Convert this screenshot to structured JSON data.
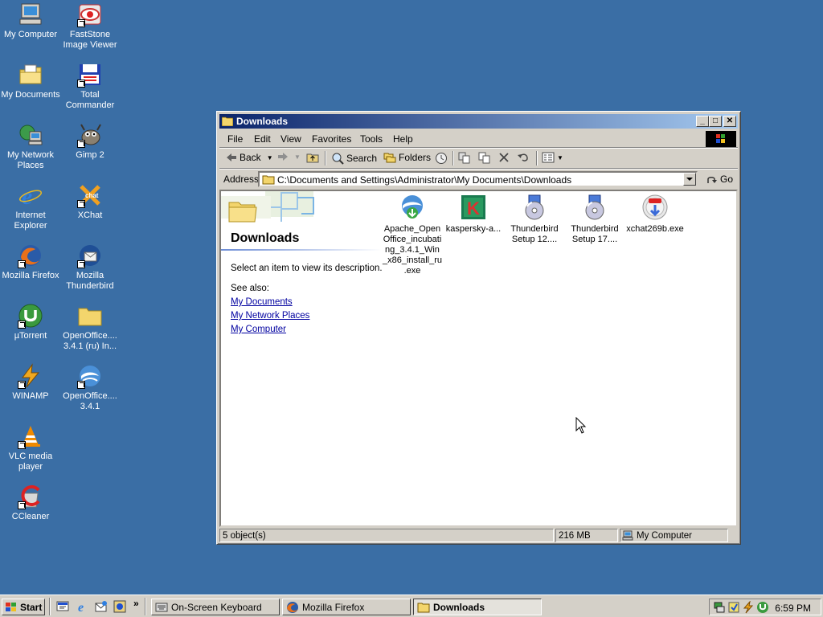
{
  "desktop": {
    "icons": [
      {
        "label": "My Computer",
        "icon": "my-computer-icon"
      },
      {
        "label": "FastStone Image Viewer",
        "icon": "faststone-icon"
      },
      {
        "label": "My Documents",
        "icon": "my-documents-icon"
      },
      {
        "label": "Total Commander",
        "icon": "total-commander-icon"
      },
      {
        "label": "My Network Places",
        "icon": "network-places-icon"
      },
      {
        "label": "Gimp 2",
        "icon": "gimp-icon"
      },
      {
        "label": "Internet Explorer",
        "icon": "internet-explorer-icon"
      },
      {
        "label": "XChat",
        "icon": "xchat-icon"
      },
      {
        "label": "Mozilla Firefox",
        "icon": "firefox-icon"
      },
      {
        "label": "Mozilla Thunderbird",
        "icon": "thunderbird-icon"
      },
      {
        "label": "µTorrent",
        "icon": "utorrent-icon"
      },
      {
        "label": "OpenOffice.... 3.4.1 (ru) In...",
        "icon": "folder-icon"
      },
      {
        "label": "WINAMP",
        "icon": "winamp-icon"
      },
      {
        "label": "OpenOffice.... 3.4.1",
        "icon": "openoffice-icon"
      },
      {
        "label": "VLC media player",
        "icon": "vlc-icon"
      },
      {
        "label": "CCleaner",
        "icon": "ccleaner-icon"
      }
    ]
  },
  "window": {
    "title": "Downloads",
    "menu": [
      "File",
      "Edit",
      "View",
      "Favorites",
      "Tools",
      "Help"
    ],
    "toolbar": {
      "back": "Back",
      "search": "Search",
      "folders": "Folders"
    },
    "address": {
      "label": "Address",
      "path": "C:\\Documents and Settings\\Administrator\\My Documents\\Downloads",
      "go": "Go"
    },
    "side_panel": {
      "title": "Downloads",
      "description": "Select an item to view its description.",
      "see_also": "See also:",
      "links": [
        "My Documents",
        "My Network Places",
        "My Computer"
      ]
    },
    "files": [
      {
        "name": "Apache_OpenOffice_incubating_3.4.1_Win_x86_install_ru.exe",
        "display": [
          "Apache_Open",
          "Office_incubati",
          "ng_3.4.1_Win",
          "_x86_install_ru",
          ".exe"
        ],
        "icon": "openoffice-installer-icon"
      },
      {
        "name": "kaspersky-a...",
        "display": [
          "kaspersky-a..."
        ],
        "icon": "kaspersky-icon"
      },
      {
        "name": "Thunderbird Setup 12....",
        "display": [
          "Thunderbird",
          "Setup 12...."
        ],
        "icon": "setup-cd-icon"
      },
      {
        "name": "Thunderbird Setup 17....",
        "display": [
          "Thunderbird",
          "Setup 17...."
        ],
        "icon": "setup-cd-icon"
      },
      {
        "name": "xchat269b.exe",
        "display": [
          "xchat269b.exe"
        ],
        "icon": "xchat-installer-icon"
      }
    ],
    "status": {
      "objects": "5 object(s)",
      "size": "216 MB",
      "zone": "My Computer"
    }
  },
  "taskbar": {
    "start": "Start",
    "tasks": [
      {
        "label": "On-Screen Keyboard",
        "active": false
      },
      {
        "label": "Mozilla Firefox",
        "active": false
      },
      {
        "label": "Downloads",
        "active": true
      }
    ],
    "clock": "6:59 PM"
  }
}
